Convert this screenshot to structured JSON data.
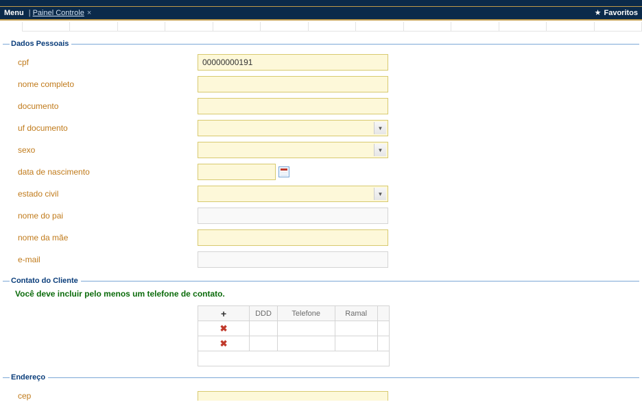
{
  "topbar": {
    "menu": "Menu",
    "separator": "|",
    "crumb": "Painel Controle",
    "favorites": "Favoritos"
  },
  "sections": {
    "personal": "Dados Pessoais",
    "contact": "Contato do Cliente",
    "address": "Endereço"
  },
  "labels": {
    "cpf": "cpf",
    "nome_completo": "nome completo",
    "documento": "documento",
    "uf_documento": "uf documento",
    "sexo": "sexo",
    "data_nascimento": "data de nascimento",
    "estado_civil": "estado civil",
    "nome_pai": "nome do pai",
    "nome_mae": "nome da mãe",
    "email": "e-mail",
    "cep": "cep"
  },
  "values": {
    "cpf": "00000000191",
    "nome_completo": "",
    "documento": "",
    "uf_documento": "",
    "sexo": "",
    "data_nascimento": "",
    "estado_civil": "",
    "nome_pai": "",
    "nome_mae": "",
    "email": "",
    "cep": ""
  },
  "contact": {
    "hint": "Você deve incluir pelo menos um telefone de contato.",
    "headers": {
      "ddd": "DDD",
      "telefone": "Telefone",
      "ramal": "Ramal"
    },
    "rows": [
      {
        "ddd": "",
        "telefone": "",
        "ramal": ""
      },
      {
        "ddd": "",
        "telefone": "",
        "ramal": ""
      }
    ]
  }
}
